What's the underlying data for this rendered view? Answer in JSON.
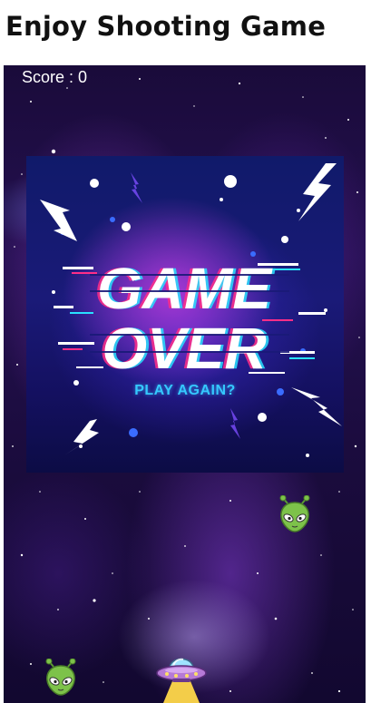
{
  "page": {
    "title": "Enjoy Shooting Game"
  },
  "game": {
    "score_text": "Score : 0",
    "score_value": 0
  },
  "gameover": {
    "line1": "GAME",
    "line2": "OVER",
    "play_again": "PLAY AGAIN?"
  },
  "icons": {
    "enemy": "alien-icon",
    "player": "ufo-icon",
    "effects": "lightning-bolt-icon"
  },
  "colors": {
    "background": "#1b0c3e",
    "nebula": "#9b3cd2",
    "card": "#141060",
    "play_again": "#35c8ff",
    "alien": "#7dc24a"
  }
}
